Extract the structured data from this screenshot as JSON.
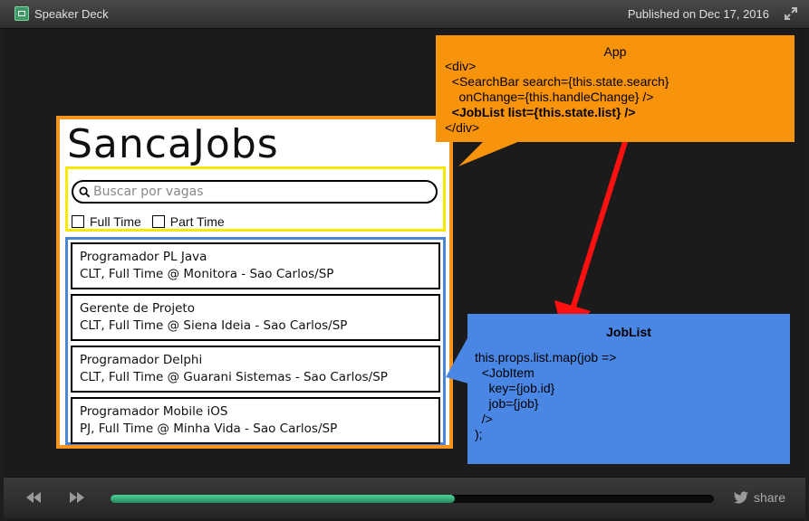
{
  "topbar": {
    "brand": "Speaker Deck",
    "published": "Published on Dec 17, 2016"
  },
  "slide": {
    "mockup": {
      "title": "SancaJobs",
      "search_placeholder": "Buscar por vagas",
      "filters": [
        "Full Time",
        "Part Time"
      ],
      "jobs": [
        {
          "title": "Programador PL Java",
          "details": "CLT, Full Time @ Monitora - Sao Carlos/SP"
        },
        {
          "title": "Gerente de Projeto",
          "details": "CLT, Full Time @ Siena Ideia - Sao Carlos/SP"
        },
        {
          "title": "Programador Delphi",
          "details": "CLT, Full Time @ Guarani Sistemas - Sao Carlos/SP"
        },
        {
          "title": "Programador Mobile iOS",
          "details": "PJ, Full Time @ Minha Vida - Sao Carlos/SP"
        }
      ]
    },
    "app_callout": {
      "title": "App",
      "lines": [
        "<div>",
        "  <SearchBar search={this.state.search}",
        "    onChange={this.handleChange} />",
        "  <JobList list={this.state.list} />",
        "</div>"
      ]
    },
    "joblist_callout": {
      "title": "JobList",
      "lines": [
        "this.props.list.map(job =>",
        "  <JobItem",
        "    key={job.id}",
        "    job={job}",
        "  />",
        ");"
      ]
    }
  },
  "controls": {
    "share_label": "share",
    "progress": 0.57
  },
  "colors": {
    "mockup_border": "#f7941d",
    "searchbar_border": "#f5ea00",
    "joblist_border": "#4a86d6",
    "app_callout": "#f8940c",
    "joblist_callout": "#4a86e4",
    "arrow": "#ff0000",
    "progress": "#2fa46d"
  },
  "icons": {
    "brand": "speakerdeck-logo-icon",
    "expand": "expand-icon",
    "search": "search-icon",
    "prev": "rewind-icon",
    "next": "fast-forward-icon",
    "share": "twitter-bird-icon"
  }
}
